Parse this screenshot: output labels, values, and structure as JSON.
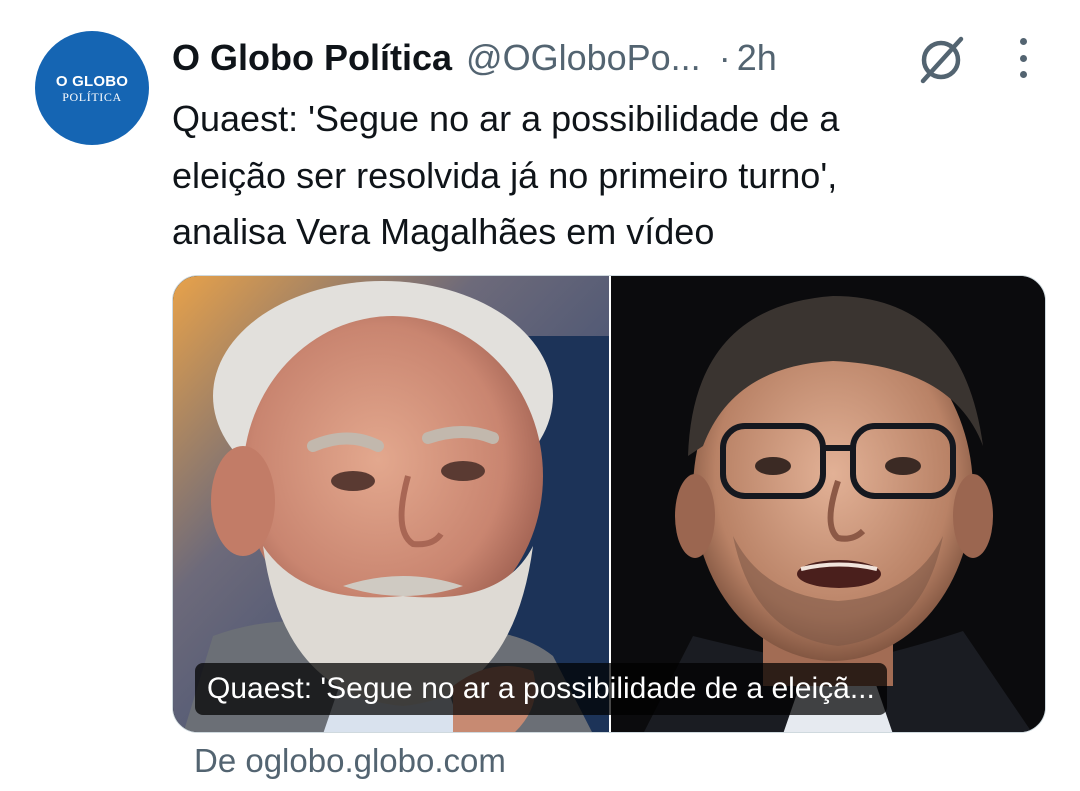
{
  "author": {
    "display_name": "O Globo Política",
    "handle": "@OGloboPo...",
    "separator": "·",
    "time": "2h",
    "avatar_line1": "O GLOBO",
    "avatar_line2": "POLÍTICA"
  },
  "tweet": {
    "text_lines": [
      "Quaest: 'Segue no ar a possibilidade de a",
      "eleição ser resolvida já no primeiro turno',",
      "analisa Vera Magalhães em vídeo"
    ]
  },
  "card": {
    "caption": "Quaest: 'Segue no ar a possibilidade de a eleiçã...",
    "source": "De oglobo.globo.com"
  },
  "icons": {
    "grok": "grok-icon",
    "more": "more-icon"
  },
  "colors": {
    "avatar_bg": "#1565b3",
    "secondary_text": "#536471",
    "primary_text": "#0f1419"
  }
}
